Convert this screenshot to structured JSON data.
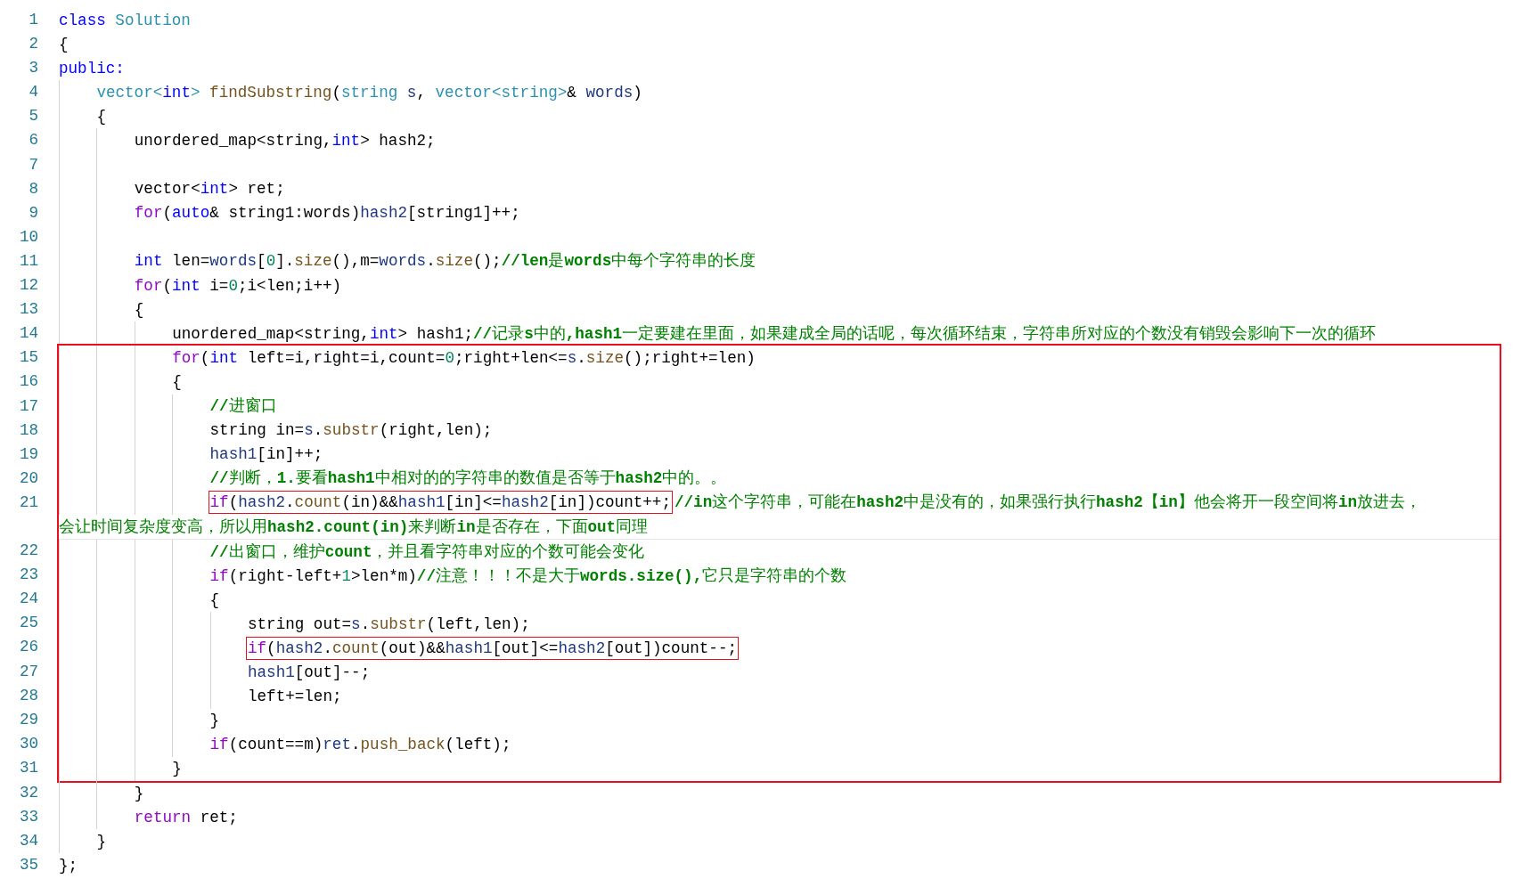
{
  "lines": [
    {
      "number": "1",
      "tokens": [
        {
          "kind": "k",
          "text": "class "
        },
        {
          "kind": "t",
          "text": "Solution"
        }
      ],
      "boxed": false,
      "framed": false
    },
    {
      "number": "2",
      "tokens": [
        {
          "kind": "p",
          "text": "{"
        }
      ],
      "boxed": false,
      "framed": false
    },
    {
      "number": "3",
      "tokens": [
        {
          "kind": "k",
          "text": "public:"
        }
      ],
      "boxed": false,
      "framed": false,
      "children": [
        {
          "number": "4",
          "tokens": [
            {
              "kind": "t",
              "text": "vector<"
            },
            {
              "kind": "k",
              "text": "int"
            },
            {
              "kind": "t",
              "text": "> "
            },
            {
              "kind": "f",
              "text": "findSubstring"
            },
            {
              "kind": "p",
              "text": "("
            },
            {
              "kind": "t",
              "text": "string"
            },
            {
              "kind": "v",
              "text": " s"
            },
            {
              "kind": "p",
              "text": ", "
            },
            {
              "kind": "t",
              "text": "vector<string>"
            },
            {
              "kind": "p",
              "text": "& "
            },
            {
              "kind": "v",
              "text": "words"
            },
            {
              "kind": "p",
              "text": ")"
            }
          ],
          "boxed": false,
          "framed": false
        },
        {
          "number": "5",
          "tokens": [
            {
              "kind": "p",
              "text": "{"
            }
          ],
          "boxed": false,
          "framed": false,
          "children": [
            {
              "number": "6",
              "tokens": [
                {
                  "kind": "p",
                  "text": "unordered_map<string,"
                },
                {
                  "kind": "k",
                  "text": "int"
                },
                {
                  "kind": "p",
                  "text": "> hash2;"
                }
              ],
              "boxed": false,
              "framed": false
            },
            {
              "number": "7",
              "boxed": false,
              "framed": false
            },
            {
              "number": "8",
              "tokens": [
                {
                  "kind": "p",
                  "text": "vector<"
                },
                {
                  "kind": "k",
                  "text": "int"
                },
                {
                  "kind": "p",
                  "text": "> ret;"
                }
              ],
              "boxed": false,
              "framed": false
            },
            {
              "number": "9",
              "tokens": [
                {
                  "kind": "c",
                  "text": "for"
                },
                {
                  "kind": "p",
                  "text": "("
                },
                {
                  "kind": "k",
                  "text": "auto"
                },
                {
                  "kind": "p",
                  "text": "& string1:words)"
                },
                {
                  "kind": "v",
                  "text": "hash2"
                },
                {
                  "kind": "p",
                  "text": "[string1]++;"
                }
              ],
              "boxed": false,
              "framed": false
            },
            {
              "number": "10",
              "boxed": false,
              "framed": false
            },
            {
              "number": "11",
              "tokens": [
                {
                  "kind": "k",
                  "text": "int"
                },
                {
                  "kind": "p",
                  "text": " len="
                },
                {
                  "kind": "v",
                  "text": "words"
                },
                {
                  "kind": "p",
                  "text": "["
                },
                {
                  "kind": "n",
                  "text": "0"
                },
                {
                  "kind": "p",
                  "text": "]."
                },
                {
                  "kind": "f",
                  "text": "size"
                },
                {
                  "kind": "p",
                  "text": "(),m="
                },
                {
                  "kind": "v",
                  "text": "words"
                },
                {
                  "kind": "p",
                  "text": "."
                },
                {
                  "kind": "f",
                  "text": "size"
                },
                {
                  "kind": "p",
                  "text": "();"
                }
              ],
              "comment": "//len是words中每个字符串的长度",
              "boxed": false,
              "framed": false
            },
            {
              "number": "12",
              "tokens": [
                {
                  "kind": "c",
                  "text": "for"
                },
                {
                  "kind": "p",
                  "text": "("
                },
                {
                  "kind": "k",
                  "text": "int"
                },
                {
                  "kind": "p",
                  "text": " i="
                },
                {
                  "kind": "n",
                  "text": "0"
                },
                {
                  "kind": "p",
                  "text": ";i<len;i++)"
                }
              ],
              "boxed": false,
              "framed": false
            },
            {
              "number": "13",
              "tokens": [
                {
                  "kind": "p",
                  "text": "{"
                }
              ],
              "boxed": false,
              "framed": false,
              "children": [
                {
                  "number": "14",
                  "tokens": [
                    {
                      "kind": "p",
                      "text": "unordered_map<string,"
                    },
                    {
                      "kind": "k",
                      "text": "int"
                    },
                    {
                      "kind": "p",
                      "text": "> hash1;"
                    }
                  ],
                  "comment": "//记录s中的,hash1一定要建在里面，如果建成全局的话呢，每次循环结束，字符串所对应的个数没有销毁会影响下一次的循环",
                  "boxed": false,
                  "framed": false
                },
                {
                  "number": "15",
                  "tokens": [
                    {
                      "kind": "c",
                      "text": "for"
                    },
                    {
                      "kind": "p",
                      "text": "("
                    },
                    {
                      "kind": "k",
                      "text": "int"
                    },
                    {
                      "kind": "p",
                      "text": " left=i,right=i,count="
                    },
                    {
                      "kind": "n",
                      "text": "0"
                    },
                    {
                      "kind": "p",
                      "text": ";right+len<="
                    },
                    {
                      "kind": "v",
                      "text": "s"
                    },
                    {
                      "kind": "p",
                      "text": "."
                    },
                    {
                      "kind": "f",
                      "text": "size"
                    },
                    {
                      "kind": "p",
                      "text": "();right+=len)"
                    }
                  ],
                  "boxed": false,
                  "framed": true
                },
                {
                  "number": "16",
                  "tokens": [
                    {
                      "kind": "p",
                      "text": "{"
                    }
                  ],
                  "boxed": false,
                  "framed": true,
                  "children": [
                    {
                      "number": "17",
                      "comment": "//进窗口",
                      "boxed": false,
                      "framed": true
                    },
                    {
                      "number": "18",
                      "tokens": [
                        {
                          "kind": "p",
                          "text": "string in="
                        },
                        {
                          "kind": "v",
                          "text": "s"
                        },
                        {
                          "kind": "p",
                          "text": "."
                        },
                        {
                          "kind": "f",
                          "text": "substr"
                        },
                        {
                          "kind": "p",
                          "text": "(right,len);"
                        }
                      ],
                      "boxed": false,
                      "framed": true
                    },
                    {
                      "number": "19",
                      "tokens": [
                        {
                          "kind": "v",
                          "text": "hash1"
                        },
                        {
                          "kind": "p",
                          "text": "[in]++;"
                        }
                      ],
                      "boxed": false,
                      "framed": true
                    },
                    {
                      "number": "20",
                      "comment": "//判断，1.要看hash1中相对的的字符串的数值是否等于hash2中的。。",
                      "boxed": false,
                      "framed": true
                    },
                    {
                      "number": "21",
                      "tokens": [
                        {
                          "kind": "c",
                          "text": "if"
                        },
                        {
                          "kind": "p",
                          "text": "("
                        },
                        {
                          "kind": "v",
                          "text": "hash2"
                        },
                        {
                          "kind": "p",
                          "text": "."
                        },
                        {
                          "kind": "f",
                          "text": "count"
                        },
                        {
                          "kind": "p",
                          "text": "(in)&&"
                        },
                        {
                          "kind": "v",
                          "text": "hash1"
                        },
                        {
                          "kind": "p",
                          "text": "[in]<="
                        },
                        {
                          "kind": "v",
                          "text": "hash2"
                        },
                        {
                          "kind": "p",
                          "text": "[in])count++;"
                        }
                      ],
                      "comment": "//in这个字符串，可能在hash2中是没有的，如果强行执行hash2【in】他会将开一段空间将in放进去，",
                      "comment_wrap": "会让时间复杂度变高，所以用hash2.count(in)来判断in是否存在，下面out同理",
                      "boxed": true,
                      "framed": true
                    },
                    {
                      "number": "22",
                      "comment": "//出窗口，维护count，并且看字符串对应的个数可能会变化",
                      "boxed": false,
                      "framed": true
                    },
                    {
                      "number": "23",
                      "tokens": [
                        {
                          "kind": "c",
                          "text": "if"
                        },
                        {
                          "kind": "p",
                          "text": "(right-left+"
                        },
                        {
                          "kind": "n",
                          "text": "1"
                        },
                        {
                          "kind": "p",
                          "text": ">len*m)"
                        }
                      ],
                      "comment": "//注意！！！不是大于words.size(),它只是字符串的个数",
                      "boxed": false,
                      "framed": true
                    },
                    {
                      "number": "24",
                      "tokens": [
                        {
                          "kind": "p",
                          "text": "{"
                        }
                      ],
                      "boxed": false,
                      "framed": true,
                      "children": [
                        {
                          "number": "25",
                          "tokens": [
                            {
                              "kind": "p",
                              "text": "string out="
                            },
                            {
                              "kind": "v",
                              "text": "s"
                            },
                            {
                              "kind": "p",
                              "text": "."
                            },
                            {
                              "kind": "f",
                              "text": "substr"
                            },
                            {
                              "kind": "p",
                              "text": "(left,len);"
                            }
                          ],
                          "boxed": false,
                          "framed": true
                        },
                        {
                          "number": "26",
                          "tokens": [
                            {
                              "kind": "c",
                              "text": "if"
                            },
                            {
                              "kind": "p",
                              "text": "("
                            },
                            {
                              "kind": "v",
                              "text": "hash2"
                            },
                            {
                              "kind": "p",
                              "text": "."
                            },
                            {
                              "kind": "f",
                              "text": "count"
                            },
                            {
                              "kind": "p",
                              "text": "(out)&&"
                            },
                            {
                              "kind": "v",
                              "text": "hash1"
                            },
                            {
                              "kind": "p",
                              "text": "[out]<="
                            },
                            {
                              "kind": "v",
                              "text": "hash2"
                            },
                            {
                              "kind": "p",
                              "text": "[out])count--;"
                            }
                          ],
                          "boxed": true,
                          "framed": true
                        },
                        {
                          "number": "27",
                          "tokens": [
                            {
                              "kind": "v",
                              "text": "hash1"
                            },
                            {
                              "kind": "p",
                              "text": "[out]--;"
                            }
                          ],
                          "boxed": false,
                          "framed": true
                        },
                        {
                          "number": "28",
                          "tokens": [
                            {
                              "kind": "p",
                              "text": "left+=len;"
                            }
                          ],
                          "boxed": false,
                          "framed": true
                        }
                      ]
                    },
                    {
                      "number": "29",
                      "tokens": [
                        {
                          "kind": "p",
                          "text": "}"
                        }
                      ],
                      "boxed": false,
                      "framed": true
                    },
                    {
                      "number": "30",
                      "tokens": [
                        {
                          "kind": "c",
                          "text": "if"
                        },
                        {
                          "kind": "p",
                          "text": "(count==m)"
                        },
                        {
                          "kind": "v",
                          "text": "ret"
                        },
                        {
                          "kind": "p",
                          "text": "."
                        },
                        {
                          "kind": "f",
                          "text": "push_back"
                        },
                        {
                          "kind": "p",
                          "text": "(left);"
                        }
                      ],
                      "boxed": false,
                      "framed": true
                    }
                  ]
                },
                {
                  "number": "31",
                  "tokens": [
                    {
                      "kind": "p",
                      "text": "}"
                    }
                  ],
                  "boxed": false,
                  "framed": true
                }
              ]
            },
            {
              "number": "32",
              "tokens": [
                {
                  "kind": "p",
                  "text": "}"
                }
              ],
              "boxed": false,
              "framed": false
            },
            {
              "number": "33",
              "tokens": [
                {
                  "kind": "c",
                  "text": "return"
                },
                {
                  "kind": "p",
                  "text": " ret;"
                }
              ],
              "boxed": false,
              "framed": false
            }
          ]
        },
        {
          "number": "34",
          "tokens": [
            {
              "kind": "p",
              "text": "}"
            }
          ],
          "boxed": false,
          "framed": false
        }
      ]
    },
    {
      "number": "35",
      "tokens": [
        {
          "kind": "p",
          "text": "};"
        }
      ],
      "boxed": false,
      "framed": false
    }
  ]
}
